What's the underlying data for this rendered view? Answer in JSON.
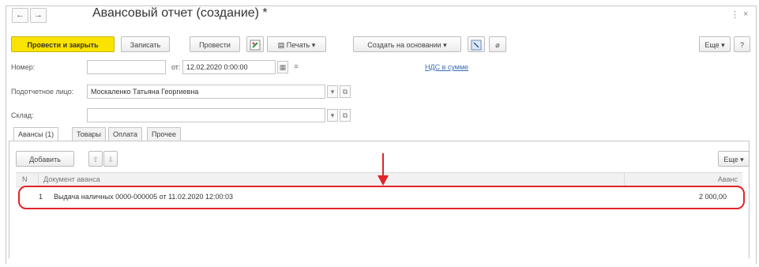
{
  "window": {
    "title": "Авансовый отчет (создание) *",
    "back_icon": "←",
    "forward_icon": "→",
    "more_icon": "⋮",
    "close_icon": "×"
  },
  "toolbar": {
    "post_and_close": "Провести и закрыть",
    "save": "Записать",
    "post": "Провести",
    "dt_kt_icon": "dt-kt-icon",
    "print": "Печать",
    "create_based_on": "Создать на основании",
    "more": "Еще",
    "help": "?"
  },
  "form": {
    "number_label": "Номер:",
    "number_value": "",
    "date_from_label": "от:",
    "date_value": "12.02.2020  0:00:00",
    "vat_link": "НДС в сумме",
    "accountable_label": "Подотчетное лицо:",
    "accountable_value": "Москаленко Татьяна Георгиевна",
    "warehouse_label": "Склад:",
    "warehouse_value": ""
  },
  "tabs": [
    {
      "label": "Авансы (1)",
      "active": true
    },
    {
      "label": "Товары",
      "active": false
    },
    {
      "label": "Оплата",
      "active": false
    },
    {
      "label": "Прочее",
      "active": false
    }
  ],
  "table_toolbar": {
    "add": "Добавить",
    "move_up_icon": "⇧",
    "move_down_icon": "⇩",
    "more": "Еще"
  },
  "table": {
    "columns": [
      "N",
      "Документ аванса",
      "Аванс"
    ],
    "rows": [
      {
        "n": "1",
        "document": "Выдача наличных 0000-000005 от 11.02.2020 12:00:03",
        "amount": "2 000,00"
      }
    ]
  },
  "annotation": {
    "highlight_color": "#e2242a"
  }
}
